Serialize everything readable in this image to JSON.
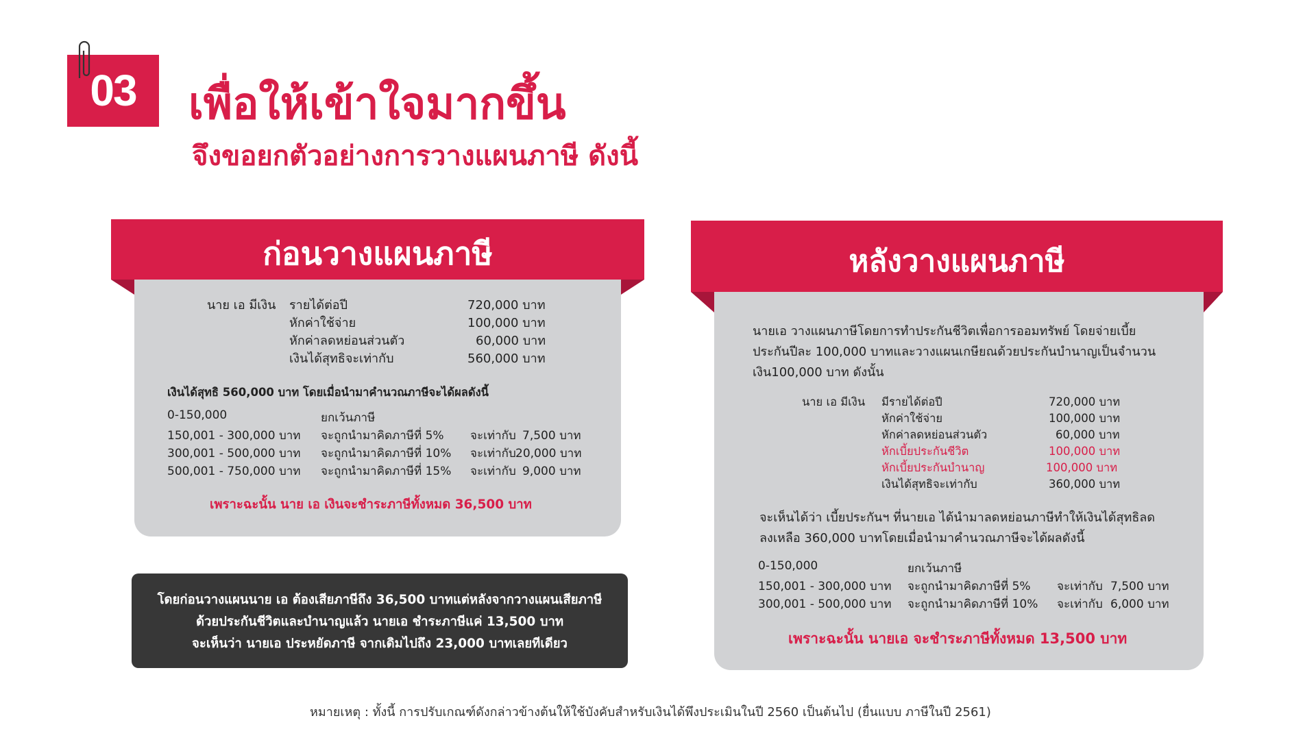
{
  "header": {
    "number": "03",
    "title": "เพื่อให้เข้าใจมากขึ้น",
    "subtitle": "จึงขอยกตัวอย่างการวางแผนภาษี  ดังนี้"
  },
  "before": {
    "heading": "ก่อนวางแผนภาษี",
    "person": "นาย เอ มีเงิน",
    "income_rows": [
      {
        "label": "รายได้ต่อปี",
        "value": "720,000 บาท"
      },
      {
        "label": "หักค่าใช้จ่าย",
        "value": "100,000 บาท"
      },
      {
        "label": "หักค่าลดหย่อนส่วนตัว",
        "value": "60,000 บาท"
      },
      {
        "label": "เงินได้สุทธิจะเท่ากับ",
        "value": "560,000 บาท"
      }
    ],
    "net_note": "เงินได้สุทธิ 560,000 บาท โดยเมื่อนำมาคำนวณภาษีจะได้ผลดังนี้",
    "tax_rows": [
      {
        "range": "0-150,000",
        "rate": "ยกเว้นภาษี",
        "eq": "",
        "amount": ""
      },
      {
        "range": "150,001 - 300,000 บาท",
        "rate": "จะถูกนำมาคิดภาษีที่   5%",
        "eq": "จะเท่ากับ",
        "amount": "7,500 บาท"
      },
      {
        "range": "300,001 - 500,000 บาท",
        "rate": "จะถูกนำมาคิดภาษีที่ 10%",
        "eq": "จะเท่ากับ",
        "amount": "20,000 บาท"
      },
      {
        "range": "500,001 - 750,000 บาท",
        "rate": "จะถูกนำมาคิดภาษีที่ 15%",
        "eq": "จะเท่ากับ",
        "amount": "9,000 บาท"
      }
    ],
    "conclusion": "เพราะฉะนั้น นาย เอ เงินจะชำระภาษีทั้งหมด 36,500 บาท"
  },
  "after": {
    "heading": "หลังวางแผนภาษี",
    "intro": [
      " นายเอ วางแผนภาษีโดยการทำประกันชีวิตเพื่อการออมทรัพย์ โดยจ่ายเบี้ย",
      "ประกันปีละ 100,000 บาทและวางแผนเกษียณด้วยประกันบำนาญเป็นจำนวน",
      "เงิน100,000 บาท ดังนั้น"
    ],
    "person": "นาย เอ มีเงิน",
    "income_rows": [
      {
        "label": "มีรายได้ต่อปี",
        "value": "720,000 บาท",
        "highlight": false
      },
      {
        "label": "หักค่าใช้จ่าย",
        "value": "100,000 บาท",
        "highlight": false
      },
      {
        "label": "หักค่าลดหย่อนส่วนตัว",
        "value": "60,000 บาท",
        "highlight": false
      },
      {
        "label": "หักเบี้ยประกันชีวิต",
        "value": "100,000 บาท",
        "highlight": true
      },
      {
        "label": "หักเบี้ยประกันบำนาญ",
        "value": "100,000  บาท",
        "highlight": true
      },
      {
        "label": "เงินได้สุทธิจะเท่ากับ",
        "value": "360,000 บาท",
        "highlight": false
      }
    ],
    "explain": [
      "จะเห็นได้ว่า เบี้ยประกันฯ ที่นายเอ ได้นำมาลดหย่อนภาษีทำให้เงินได้สุทธิลด",
      "ลงเหลือ 360,000 บาทโดยเมื่อนำมาคำนวณภาษีจะได้ผลดังนี้"
    ],
    "tax_rows": [
      {
        "range": "0-150,000",
        "rate": "ยกเว้นภาษี",
        "eq": "",
        "amount": ""
      },
      {
        "range": "150,001 - 300,000 บาท",
        "rate": "จะถูกนำมาคิดภาษีที่   5%",
        "eq": "จะเท่ากับ",
        "amount": "7,500 บาท"
      },
      {
        "range": "300,001 - 500,000 บาท",
        "rate": "จะถูกนำมาคิดภาษีที่ 10%",
        "eq": "จะเท่ากับ",
        "amount": "6,000 บาท"
      }
    ],
    "conclusion": "เพราะฉะนั้น นายเอ จะชำระภาษีทั้งหมด 13,500 บาท"
  },
  "summary": [
    "โดยก่อนวางแผนนาย เอ ต้องเสียภาษีถึง 36,500 บาทแต่หลังจากวางแผนเสียภาษี",
    "ด้วยประกันชีวิตและบำนาญแล้ว นายเอ ชำระภาษีแค่ 13,500 บาท",
    "จะเห็นว่า นายเอ ประหยัดภาษี จากเดิมไปถึง 23,000 บาทเลยทีเดียว"
  ],
  "footnote": "หมายเหตุ : ทั้งนี้ การปรับเกณฑ์ดังกล่าวข้างต้นให้ใช้บังคับสำหรับเงินได้พึงประเมินในปี 2560 เป็นต้นไป (ยื่นแบบ ภาษีในปี 2561)",
  "colors": {
    "accent": "#d81e49",
    "panel": "#d1d2d4",
    "dark": "#373737"
  }
}
